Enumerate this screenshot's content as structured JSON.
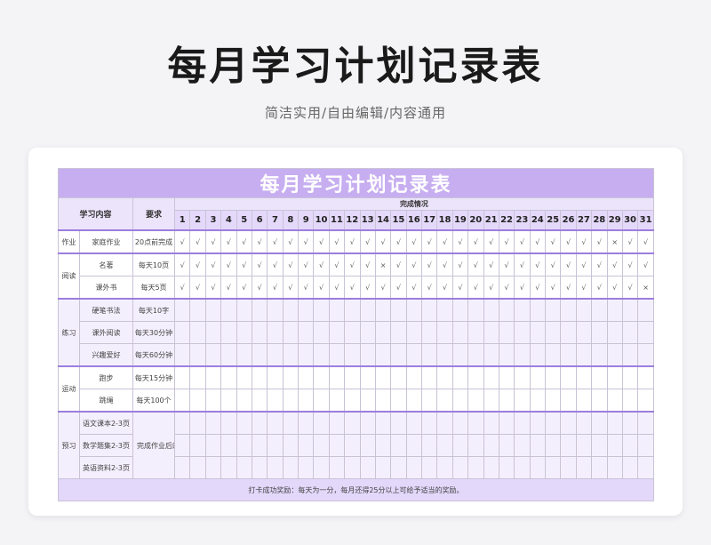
{
  "page": {
    "title": "每月学习计划记录表",
    "subtitle": "简洁实用/自由编辑/内容通用"
  },
  "sheet": {
    "title": "每月学习计划记录表",
    "headers": {
      "content": "学习内容",
      "requirement": "要求",
      "completion": "完成情况"
    },
    "days": [
      "1",
      "2",
      "3",
      "4",
      "5",
      "6",
      "7",
      "8",
      "9",
      "10",
      "11",
      "12",
      "13",
      "14",
      "15",
      "16",
      "17",
      "18",
      "19",
      "20",
      "21",
      "22",
      "23",
      "24",
      "25",
      "26",
      "27",
      "28",
      "29",
      "30",
      "31"
    ],
    "groups": [
      {
        "category": "作业",
        "band": "a",
        "rows": [
          {
            "item": "家庭作业",
            "requirement": "20点前完成",
            "marks": [
              "√",
              "√",
              "√",
              "√",
              "√",
              "√",
              "√",
              "√",
              "√",
              "√",
              "√",
              "√",
              "√",
              "√",
              "√",
              "√",
              "√",
              "√",
              "√",
              "√",
              "√",
              "√",
              "√",
              "√",
              "√",
              "√",
              "√",
              "√",
              "×",
              "√",
              "√"
            ]
          }
        ]
      },
      {
        "category": "阅读",
        "band": "a",
        "rows": [
          {
            "item": "名著",
            "requirement": "每天10页",
            "marks": [
              "√",
              "√",
              "√",
              "√",
              "√",
              "√",
              "√",
              "√",
              "√",
              "√",
              "√",
              "√",
              "√",
              "×",
              "√",
              "√",
              "√",
              "√",
              "√",
              "√",
              "√",
              "√",
              "√",
              "√",
              "√",
              "√",
              "√",
              "√",
              "√",
              "√",
              "√"
            ]
          },
          {
            "item": "课外书",
            "requirement": "每天5页",
            "marks": [
              "√",
              "√",
              "√",
              "√",
              "√",
              "√",
              "√",
              "√",
              "√",
              "√",
              "√",
              "√",
              "√",
              "√",
              "√",
              "√",
              "√",
              "√",
              "√",
              "√",
              "√",
              "√",
              "√",
              "√",
              "√",
              "√",
              "√",
              "√",
              "√",
              "√",
              "×"
            ]
          }
        ]
      },
      {
        "category": "练习",
        "band": "b",
        "rows": [
          {
            "item": "硬笔书法",
            "requirement": "每天10字",
            "marks": []
          },
          {
            "item": "课外阅读",
            "requirement": "每天30分钟",
            "marks": []
          },
          {
            "item": "兴趣爱好",
            "requirement": "每天60分钟",
            "marks": []
          }
        ]
      },
      {
        "category": "运动",
        "band": "a",
        "rows": [
          {
            "item": "跑步",
            "requirement": "每天15分钟",
            "marks": []
          },
          {
            "item": "跳绳",
            "requirement": "每天100个",
            "marks": []
          }
        ]
      },
      {
        "category": "预习",
        "band": "b",
        "shared_requirement": "完成作业后的预习",
        "rows": [
          {
            "item": "语文课本2-3页",
            "marks": []
          },
          {
            "item": "数学题集2-3页",
            "marks": []
          },
          {
            "item": "英语资料2-3页",
            "marks": []
          }
        ]
      }
    ],
    "footer": "打卡成功奖励：每天为一分，每月还得25分以上可给予适当的奖励。"
  }
}
